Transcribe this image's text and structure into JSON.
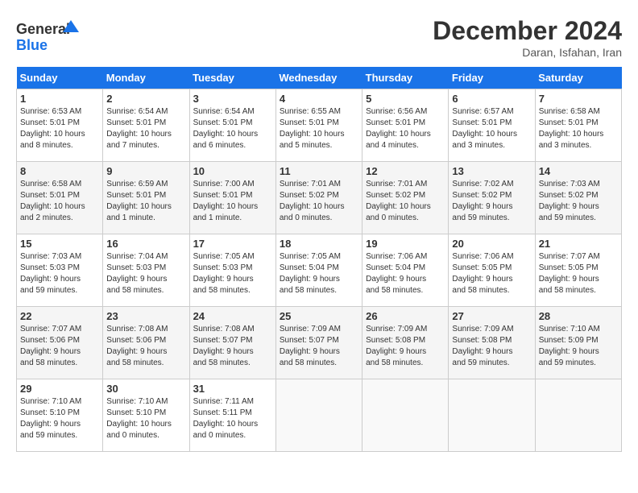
{
  "header": {
    "logo_line1": "General",
    "logo_line2": "Blue",
    "month_title": "December 2024",
    "location": "Daran, Isfahan, Iran"
  },
  "columns": [
    "Sunday",
    "Monday",
    "Tuesday",
    "Wednesday",
    "Thursday",
    "Friday",
    "Saturday"
  ],
  "weeks": [
    [
      {
        "day": "1",
        "info": "Sunrise: 6:53 AM\nSunset: 5:01 PM\nDaylight: 10 hours\nand 8 minutes."
      },
      {
        "day": "2",
        "info": "Sunrise: 6:54 AM\nSunset: 5:01 PM\nDaylight: 10 hours\nand 7 minutes."
      },
      {
        "day": "3",
        "info": "Sunrise: 6:54 AM\nSunset: 5:01 PM\nDaylight: 10 hours\nand 6 minutes."
      },
      {
        "day": "4",
        "info": "Sunrise: 6:55 AM\nSunset: 5:01 PM\nDaylight: 10 hours\nand 5 minutes."
      },
      {
        "day": "5",
        "info": "Sunrise: 6:56 AM\nSunset: 5:01 PM\nDaylight: 10 hours\nand 4 minutes."
      },
      {
        "day": "6",
        "info": "Sunrise: 6:57 AM\nSunset: 5:01 PM\nDaylight: 10 hours\nand 3 minutes."
      },
      {
        "day": "7",
        "info": "Sunrise: 6:58 AM\nSunset: 5:01 PM\nDaylight: 10 hours\nand 3 minutes."
      }
    ],
    [
      {
        "day": "8",
        "info": "Sunrise: 6:58 AM\nSunset: 5:01 PM\nDaylight: 10 hours\nand 2 minutes."
      },
      {
        "day": "9",
        "info": "Sunrise: 6:59 AM\nSunset: 5:01 PM\nDaylight: 10 hours\nand 1 minute."
      },
      {
        "day": "10",
        "info": "Sunrise: 7:00 AM\nSunset: 5:01 PM\nDaylight: 10 hours\nand 1 minute."
      },
      {
        "day": "11",
        "info": "Sunrise: 7:01 AM\nSunset: 5:02 PM\nDaylight: 10 hours\nand 0 minutes."
      },
      {
        "day": "12",
        "info": "Sunrise: 7:01 AM\nSunset: 5:02 PM\nDaylight: 10 hours\nand 0 minutes."
      },
      {
        "day": "13",
        "info": "Sunrise: 7:02 AM\nSunset: 5:02 PM\nDaylight: 9 hours\nand 59 minutes."
      },
      {
        "day": "14",
        "info": "Sunrise: 7:03 AM\nSunset: 5:02 PM\nDaylight: 9 hours\nand 59 minutes."
      }
    ],
    [
      {
        "day": "15",
        "info": "Sunrise: 7:03 AM\nSunset: 5:03 PM\nDaylight: 9 hours\nand 59 minutes."
      },
      {
        "day": "16",
        "info": "Sunrise: 7:04 AM\nSunset: 5:03 PM\nDaylight: 9 hours\nand 58 minutes."
      },
      {
        "day": "17",
        "info": "Sunrise: 7:05 AM\nSunset: 5:03 PM\nDaylight: 9 hours\nand 58 minutes."
      },
      {
        "day": "18",
        "info": "Sunrise: 7:05 AM\nSunset: 5:04 PM\nDaylight: 9 hours\nand 58 minutes."
      },
      {
        "day": "19",
        "info": "Sunrise: 7:06 AM\nSunset: 5:04 PM\nDaylight: 9 hours\nand 58 minutes."
      },
      {
        "day": "20",
        "info": "Sunrise: 7:06 AM\nSunset: 5:05 PM\nDaylight: 9 hours\nand 58 minutes."
      },
      {
        "day": "21",
        "info": "Sunrise: 7:07 AM\nSunset: 5:05 PM\nDaylight: 9 hours\nand 58 minutes."
      }
    ],
    [
      {
        "day": "22",
        "info": "Sunrise: 7:07 AM\nSunset: 5:06 PM\nDaylight: 9 hours\nand 58 minutes."
      },
      {
        "day": "23",
        "info": "Sunrise: 7:08 AM\nSunset: 5:06 PM\nDaylight: 9 hours\nand 58 minutes."
      },
      {
        "day": "24",
        "info": "Sunrise: 7:08 AM\nSunset: 5:07 PM\nDaylight: 9 hours\nand 58 minutes."
      },
      {
        "day": "25",
        "info": "Sunrise: 7:09 AM\nSunset: 5:07 PM\nDaylight: 9 hours\nand 58 minutes."
      },
      {
        "day": "26",
        "info": "Sunrise: 7:09 AM\nSunset: 5:08 PM\nDaylight: 9 hours\nand 58 minutes."
      },
      {
        "day": "27",
        "info": "Sunrise: 7:09 AM\nSunset: 5:08 PM\nDaylight: 9 hours\nand 59 minutes."
      },
      {
        "day": "28",
        "info": "Sunrise: 7:10 AM\nSunset: 5:09 PM\nDaylight: 9 hours\nand 59 minutes."
      }
    ],
    [
      {
        "day": "29",
        "info": "Sunrise: 7:10 AM\nSunset: 5:10 PM\nDaylight: 9 hours\nand 59 minutes."
      },
      {
        "day": "30",
        "info": "Sunrise: 7:10 AM\nSunset: 5:10 PM\nDaylight: 10 hours\nand 0 minutes."
      },
      {
        "day": "31",
        "info": "Sunrise: 7:11 AM\nSunset: 5:11 PM\nDaylight: 10 hours\nand 0 minutes."
      },
      {
        "day": "",
        "info": ""
      },
      {
        "day": "",
        "info": ""
      },
      {
        "day": "",
        "info": ""
      },
      {
        "day": "",
        "info": ""
      }
    ]
  ]
}
